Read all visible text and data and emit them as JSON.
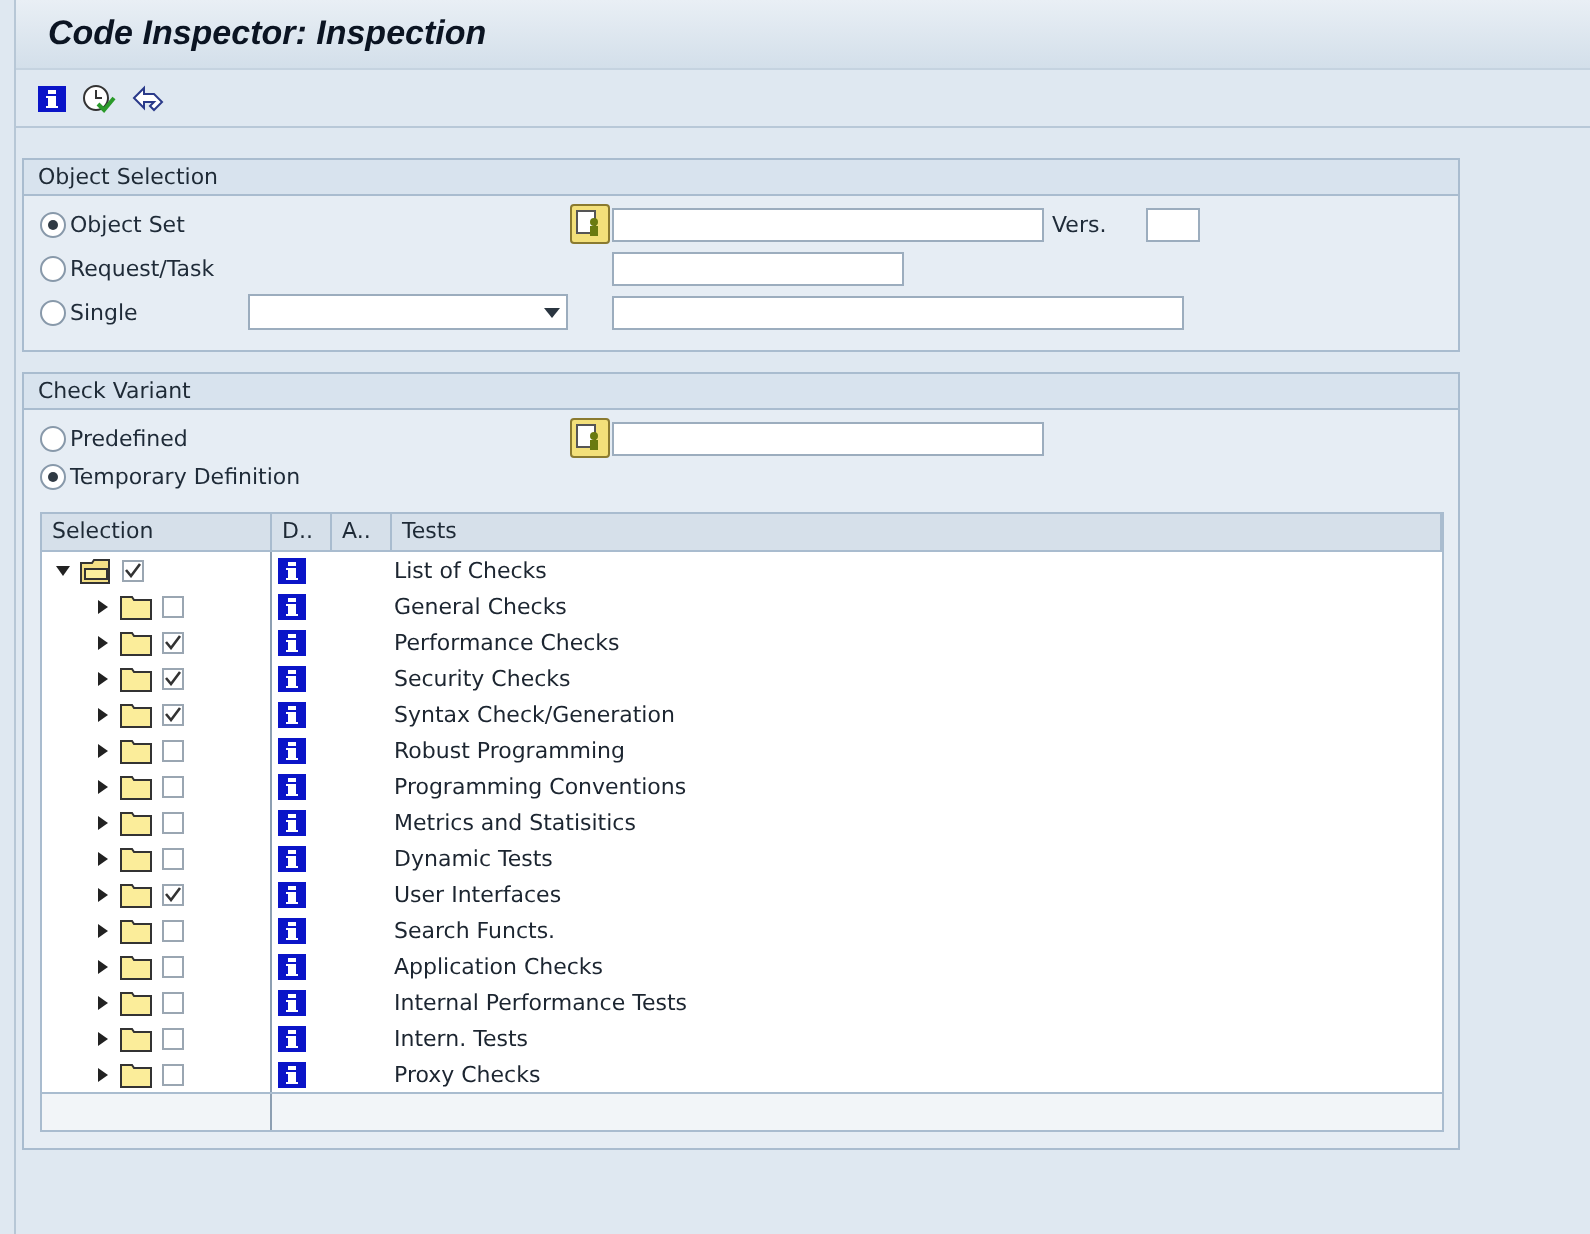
{
  "window": {
    "title": "Code Inspector: Inspection"
  },
  "toolbar": {
    "buttons": [
      {
        "kind": "info"
      },
      {
        "kind": "execute"
      },
      {
        "kind": "back"
      }
    ]
  },
  "object_selection": {
    "title": "Object Selection",
    "options": [
      {
        "label": "Object Set",
        "selected": true,
        "kind": "value_help_field",
        "version_label": "Vers."
      },
      {
        "label": "Request/Task",
        "selected": false,
        "kind": "short_field"
      },
      {
        "label": "Single",
        "selected": false,
        "kind": "dropdown_field"
      }
    ]
  },
  "check_variant": {
    "title": "Check Variant",
    "options": [
      {
        "label": "Predefined",
        "selected": false,
        "kind": "value_help_field"
      },
      {
        "label": "Temporary Definition",
        "selected": true,
        "kind": "none"
      }
    ],
    "table": {
      "columns": [
        "Selection",
        "D..",
        "A..",
        "Tests"
      ],
      "rows": [
        {
          "label": "List of Checks",
          "checked": true,
          "expanded": true,
          "children": [
            {
              "label": "General Checks",
              "checked": false,
              "expanded": false
            },
            {
              "label": "Performance Checks",
              "checked": true,
              "expanded": false
            },
            {
              "label": "Security Checks",
              "checked": true,
              "expanded": false
            },
            {
              "label": "Syntax Check/Generation",
              "checked": true,
              "expanded": false
            },
            {
              "label": "Robust Programming",
              "checked": false,
              "expanded": false
            },
            {
              "label": "Programming Conventions",
              "checked": false,
              "expanded": false
            },
            {
              "label": "Metrics and Statisitics",
              "checked": false,
              "expanded": false
            },
            {
              "label": "Dynamic Tests",
              "checked": false,
              "expanded": false
            },
            {
              "label": "User Interfaces",
              "checked": true,
              "expanded": false
            },
            {
              "label": "Search Functs.",
              "checked": false,
              "expanded": false
            },
            {
              "label": "Application Checks",
              "checked": false,
              "expanded": false
            },
            {
              "label": "Internal Performance Tests",
              "checked": false,
              "expanded": false
            },
            {
              "label": "Intern. Tests",
              "checked": false,
              "expanded": false
            },
            {
              "label": "Proxy Checks",
              "checked": false,
              "expanded": false
            }
          ]
        }
      ]
    }
  }
}
